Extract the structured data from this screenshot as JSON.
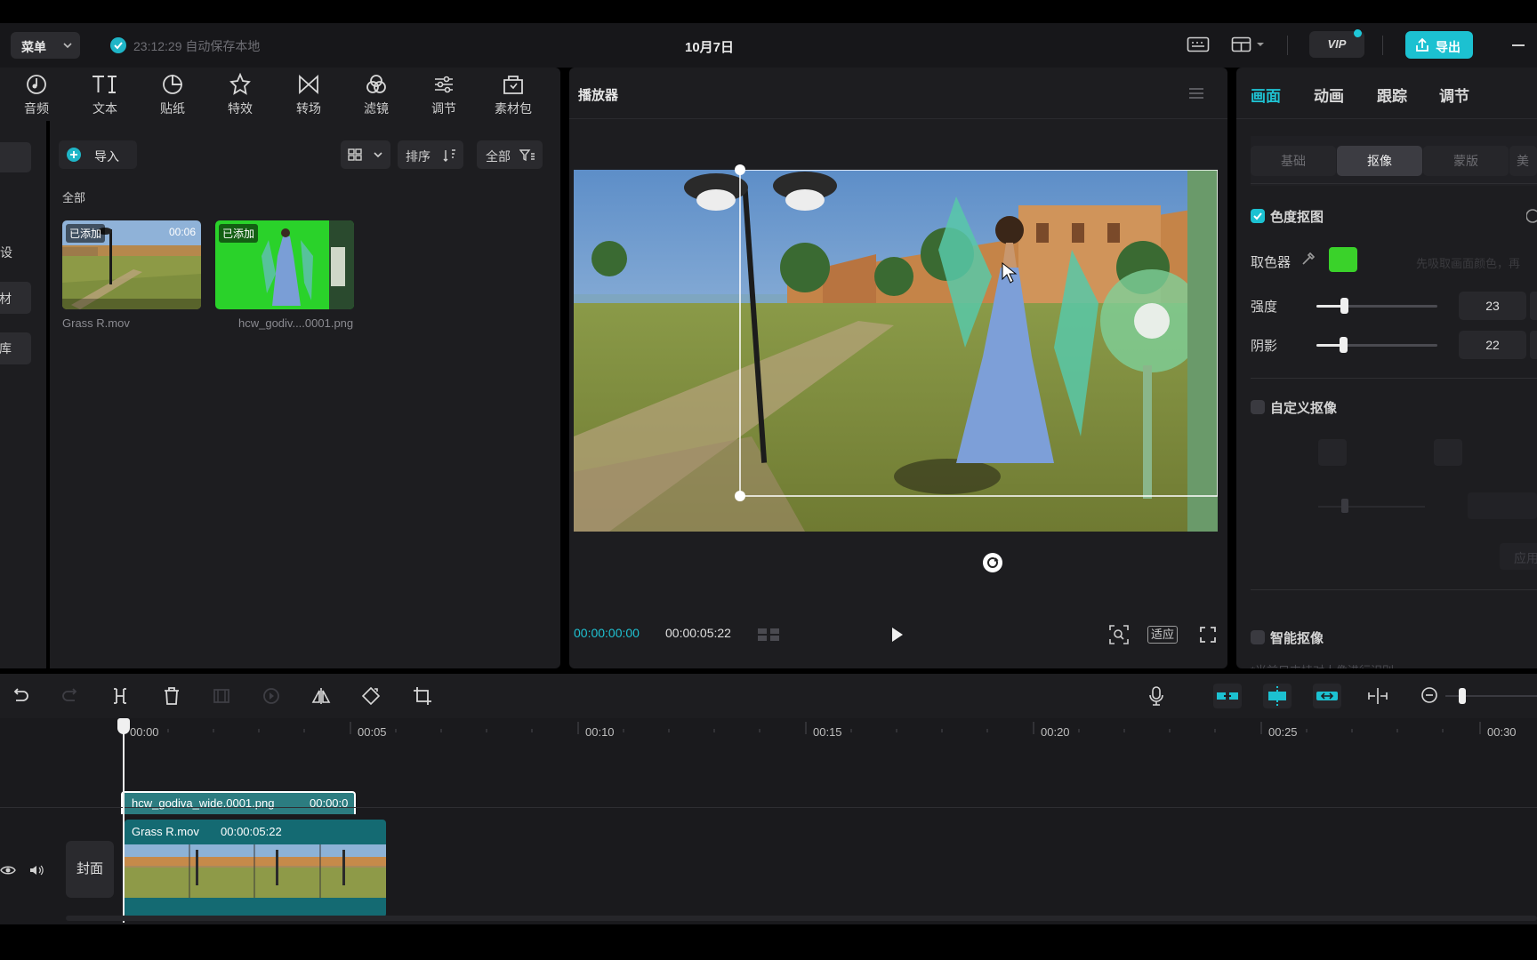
{
  "header": {
    "menu_label": "菜单",
    "autosave_text": "23:12:29 自动保存本地",
    "project_title": "10月7日",
    "vip_label": "VIP",
    "export_label": "导出"
  },
  "toolbar": {
    "items": [
      {
        "label": "音频",
        "icon": "audio-icon"
      },
      {
        "label": "文本",
        "icon": "text-icon"
      },
      {
        "label": "贴纸",
        "icon": "sticker-icon"
      },
      {
        "label": "特效",
        "icon": "effects-icon"
      },
      {
        "label": "转场",
        "icon": "transition-icon"
      },
      {
        "label": "滤镜",
        "icon": "filter-icon"
      },
      {
        "label": "调节",
        "icon": "adjust-icon"
      },
      {
        "label": "素材包",
        "icon": "package-icon"
      }
    ]
  },
  "left_strip": {
    "items": [
      "预设",
      "材",
      "库"
    ]
  },
  "media": {
    "import_label": "导入",
    "sort_label": "排序",
    "filter_label": "全部",
    "section_label": "全部",
    "items": [
      {
        "name": "Grass R.mov",
        "badge": "已添加",
        "duration": "00:06"
      },
      {
        "name": "hcw_godiv....0001.png",
        "badge": "已添加"
      }
    ]
  },
  "player": {
    "title": "播放器",
    "current_time": "00:00:00:00",
    "total_time": "00:00:05:22",
    "fit_label": "适应"
  },
  "right_panel": {
    "tabs": [
      "画面",
      "动画",
      "跟踪",
      "调节"
    ],
    "subtabs": [
      "基础",
      "抠像",
      "蒙版",
      "美"
    ],
    "chroma_key": {
      "label": "色度抠图",
      "checked": true,
      "picker_label": "取色器",
      "picker_hint": "先吸取画面颜色，再",
      "picker_color": "#3ad22a",
      "intensity_label": "强度",
      "intensity_value": "23",
      "intensity_level": 0.23,
      "shadow_label": "阴影",
      "shadow_value": "22",
      "shadow_level": 0.22
    },
    "custom_key": {
      "label": "自定义抠像",
      "checked": false,
      "apply_label": "应用"
    },
    "smart_key": {
      "label": "智能抠像",
      "checked": false,
      "hint": "*当前只支持对人像进行识别"
    }
  },
  "timeline": {
    "ruler_labels": [
      "00:00",
      "00:05",
      "00:10",
      "00:15",
      "00:20",
      "00:25",
      "00:30"
    ],
    "overlay_clip": {
      "name": "hcw_godiva_wide.0001.png",
      "duration": "00:00:0"
    },
    "main_clip": {
      "name": "Grass R.mov",
      "duration": "00:00:05:22"
    },
    "cover_label": "封面"
  },
  "colors": {
    "accent": "#1cc1d1",
    "panel": "#1d1d20",
    "background": "#000000"
  }
}
